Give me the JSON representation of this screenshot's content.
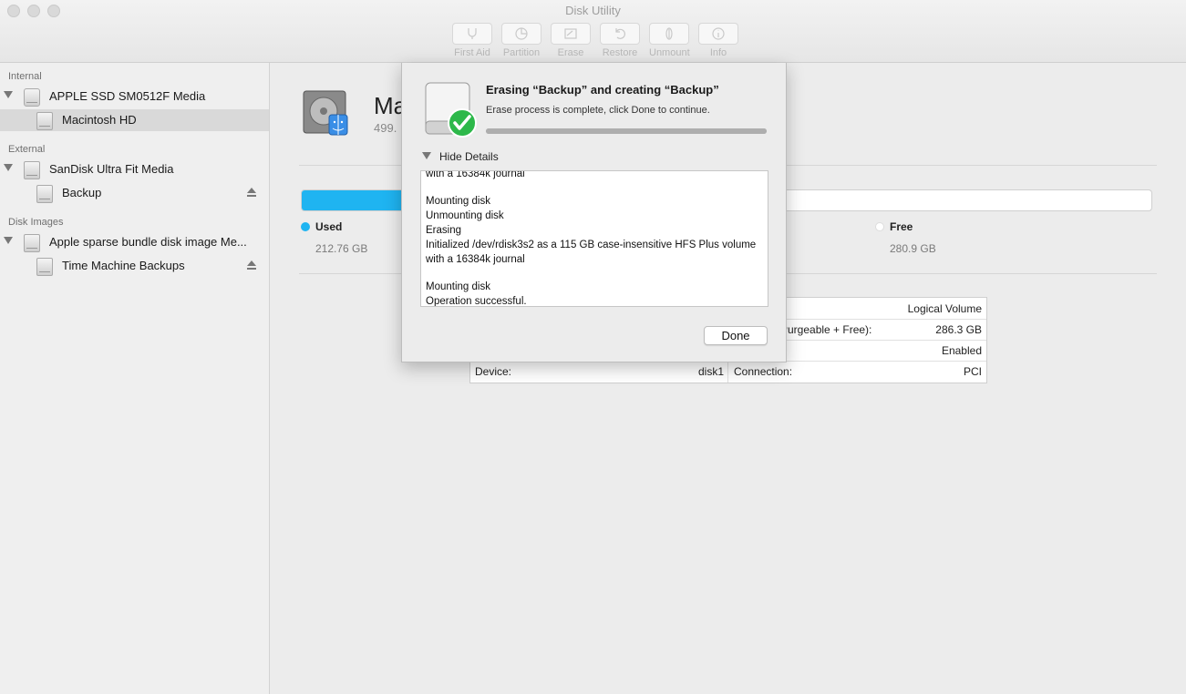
{
  "window": {
    "title": "Disk Utility"
  },
  "toolbar": {
    "first_aid": "First Aid",
    "partition": "Partition",
    "erase": "Erase",
    "restore": "Restore",
    "unmount": "Unmount",
    "info": "Info"
  },
  "sidebar": {
    "section_internal": "Internal",
    "section_external": "External",
    "section_disk_images": "Disk Images",
    "internal_media": "APPLE SSD SM0512F Media",
    "internal_volume": "Macintosh HD",
    "external_media": "SanDisk Ultra Fit Media",
    "external_volume": "Backup",
    "image_media": "Apple sparse bundle disk image Me...",
    "image_volume": "Time Machine Backups"
  },
  "main": {
    "device_name": "Ma",
    "device_subtitle": "499.",
    "used_label": "Used",
    "used_value": "212.76 GB",
    "free_label": "Free",
    "free_value": "280.9 GB",
    "used_fraction": 0.43,
    "used_color": "#1fb4f1",
    "info": {
      "r1_right_value": "Logical Volume",
      "r2_right_label": "Purgeable + Free):",
      "r2_right_value": "286.3 GB",
      "r3_right_value": "Enabled",
      "device_label": "Device:",
      "device_value": "disk1",
      "connection_label": "Connection:",
      "connection_value": "PCI"
    }
  },
  "dialog": {
    "title": "Erasing “Backup” and creating “Backup”",
    "message": "Erase process is complete, click Done to continue.",
    "progress": 1.0,
    "details_toggle": "Hide Details",
    "log_lines": [
      "with a 16384k journal",
      "",
      "Mounting disk",
      "Unmounting disk",
      "Erasing",
      "Initialized /dev/rdisk3s2 as a 115 GB case-insensitive HFS Plus volume",
      "with a 16384k journal",
      "",
      "Mounting disk",
      "Operation successful."
    ],
    "done_label": "Done",
    "check_color": "#2db84a"
  }
}
